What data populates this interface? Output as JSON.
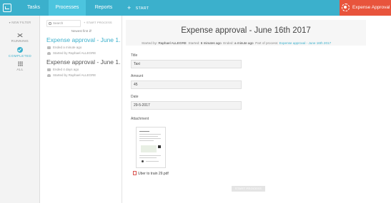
{
  "topbar": {
    "tabs": [
      {
        "label": "Tasks"
      },
      {
        "label": "Processes"
      },
      {
        "label": "Reports"
      }
    ],
    "start_label": "START",
    "app_name": "Expense Approval"
  },
  "filters": {
    "new_filter_label": "NEW FILTER",
    "items": [
      {
        "label": "RUNNING",
        "icon": "shuffle-icon"
      },
      {
        "label": "COMPLETED",
        "icon": "check-circle-icon",
        "selected": true
      },
      {
        "label": "ALL",
        "icon": "grid-icon"
      }
    ]
  },
  "list": {
    "search_placeholder": "Search",
    "start_process_label": "START PROCESS",
    "sort_label": "Newest first",
    "items": [
      {
        "title": "Expense approval - June 1...",
        "ended": "Ended a minute ago",
        "started_by": "Started by Raphael ALLEGRE"
      },
      {
        "title": "Expense approval - June 1...",
        "ended": "Ended 4 days ago",
        "started_by": "Started by Raphael ALLEGRE"
      }
    ]
  },
  "detail": {
    "title": "Expense approval - June 16th 2017",
    "meta": {
      "started_by_label": "Started by:",
      "started_by": "Raphael ALLEGRE",
      "started_label": "Started:",
      "started": "6 minutes ago",
      "ended_label": "Ended:",
      "ended": "a minute ago",
      "part_of_label": "Part of process:",
      "part_of": "Expense approval - June 16th 2017"
    },
    "fields": [
      {
        "label": "Title",
        "value": "Taxi"
      },
      {
        "label": "Amount",
        "value": "45"
      },
      {
        "label": "Date",
        "value": "29-5-2017"
      }
    ],
    "attachment_label": "Attachment",
    "attachment_file": "Uber to train 29.pdf",
    "start_process_button": "START PROCESS"
  },
  "colors": {
    "accent": "#3bb0cc",
    "brand_badge": "#e8543c"
  }
}
